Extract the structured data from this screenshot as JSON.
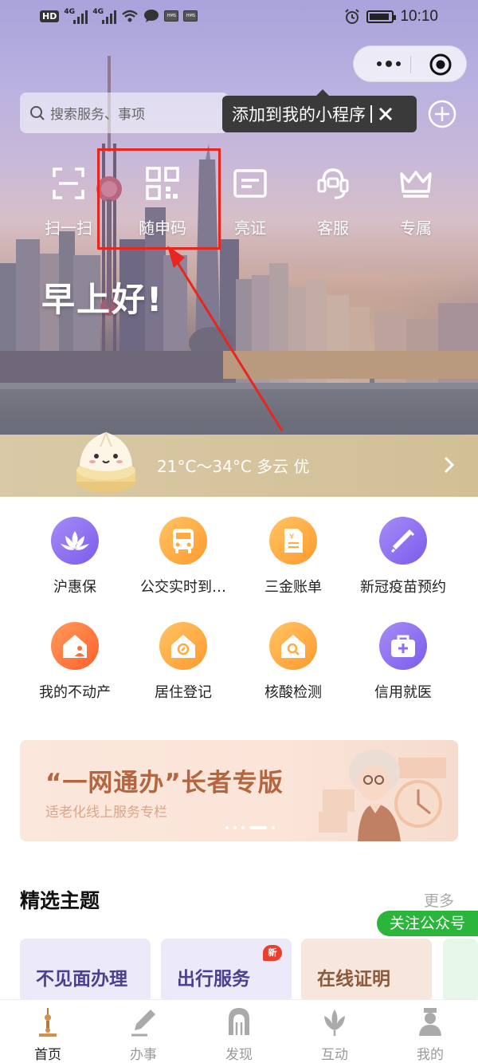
{
  "status_bar": {
    "hd_label": "HD",
    "network_1": "4G",
    "network_2": "4G",
    "small_1": "HMS",
    "small_2": "HMS",
    "time": "10:10"
  },
  "header": {
    "search_placeholder": "搜索服务、事项",
    "tooltip": "添加到我的小程序"
  },
  "quick_actions": [
    {
      "label": "扫一扫",
      "icon": "scan-icon"
    },
    {
      "label": "随申码",
      "icon": "qr-code-icon"
    },
    {
      "label": "亮证",
      "icon": "id-card-icon"
    },
    {
      "label": "客服",
      "icon": "customer-service-icon"
    },
    {
      "label": "专属",
      "icon": "crown-icon"
    }
  ],
  "greeting": "早上好!",
  "weather": {
    "text": "21°C～34°C 多云 优"
  },
  "services": [
    {
      "label": "沪惠保",
      "icon": "lotus-icon",
      "color": "#8c6cf0"
    },
    {
      "label": "公交实时到…",
      "icon": "bus-icon",
      "color": "#ffa53a"
    },
    {
      "label": "三金账单",
      "icon": "bill-icon",
      "color": "#ffa53a"
    },
    {
      "label": "新冠疫苗预约",
      "icon": "vaccine-icon",
      "color": "#8c6cf0"
    },
    {
      "label": "我的不动产",
      "icon": "house-user-icon",
      "color": "#ff6f3c"
    },
    {
      "label": "居住登记",
      "icon": "home-compass-icon",
      "color": "#ffa53a"
    },
    {
      "label": "核酸检测",
      "icon": "home-search-icon",
      "color": "#ffa53a"
    },
    {
      "label": "信用就医",
      "icon": "medical-kit-icon",
      "color": "#8c6cf0"
    }
  ],
  "banner": {
    "title": "“一网通办”长者专版",
    "subtitle": "适老化线上服务专栏"
  },
  "section": {
    "title": "精选主题",
    "more": "更多",
    "follow": "关注公众号",
    "topics": [
      {
        "label": "不见面办理",
        "color": "#4b3f8f",
        "bg": "#ece9f8"
      },
      {
        "label": "出行服务",
        "color": "#4b3f8f",
        "bg": "#ece9f8",
        "badge": "新"
      },
      {
        "label": "在线证明",
        "color": "#8a5a3a",
        "bg": "#f6e6dc"
      }
    ]
  },
  "tabbar": [
    {
      "label": "首页",
      "icon": "home-tower-icon",
      "active": true
    },
    {
      "label": "办事",
      "icon": "pen-nib-icon",
      "active": false
    },
    {
      "label": "发现",
      "icon": "arch-icon",
      "active": false
    },
    {
      "label": "互动",
      "icon": "magnolia-icon",
      "active": false
    },
    {
      "label": "我的",
      "icon": "profile-icon",
      "active": false
    }
  ]
}
